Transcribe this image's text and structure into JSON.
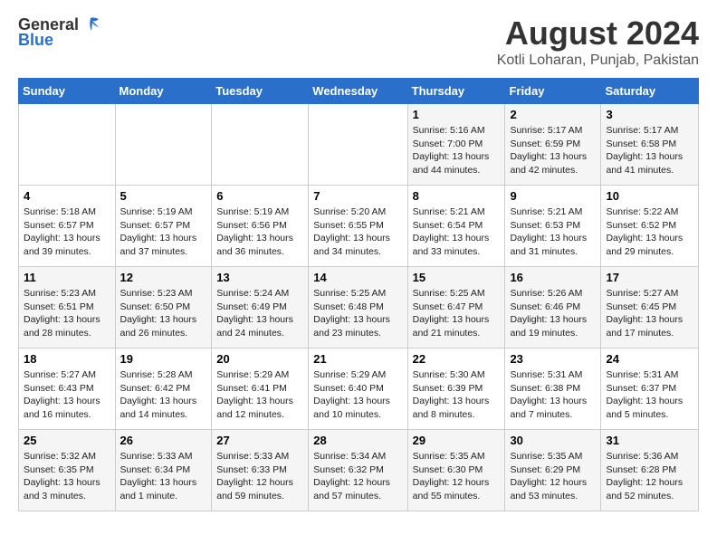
{
  "logo": {
    "general": "General",
    "blue": "Blue"
  },
  "title": "August 2024",
  "subtitle": "Kotli Loharan, Punjab, Pakistan",
  "days_of_week": [
    "Sunday",
    "Monday",
    "Tuesday",
    "Wednesday",
    "Thursday",
    "Friday",
    "Saturday"
  ],
  "weeks": [
    [
      {
        "day": "",
        "info": ""
      },
      {
        "day": "",
        "info": ""
      },
      {
        "day": "",
        "info": ""
      },
      {
        "day": "",
        "info": ""
      },
      {
        "day": "1",
        "info": "Sunrise: 5:16 AM\nSunset: 7:00 PM\nDaylight: 13 hours\nand 44 minutes."
      },
      {
        "day": "2",
        "info": "Sunrise: 5:17 AM\nSunset: 6:59 PM\nDaylight: 13 hours\nand 42 minutes."
      },
      {
        "day": "3",
        "info": "Sunrise: 5:17 AM\nSunset: 6:58 PM\nDaylight: 13 hours\nand 41 minutes."
      }
    ],
    [
      {
        "day": "4",
        "info": "Sunrise: 5:18 AM\nSunset: 6:57 PM\nDaylight: 13 hours\nand 39 minutes."
      },
      {
        "day": "5",
        "info": "Sunrise: 5:19 AM\nSunset: 6:57 PM\nDaylight: 13 hours\nand 37 minutes."
      },
      {
        "day": "6",
        "info": "Sunrise: 5:19 AM\nSunset: 6:56 PM\nDaylight: 13 hours\nand 36 minutes."
      },
      {
        "day": "7",
        "info": "Sunrise: 5:20 AM\nSunset: 6:55 PM\nDaylight: 13 hours\nand 34 minutes."
      },
      {
        "day": "8",
        "info": "Sunrise: 5:21 AM\nSunset: 6:54 PM\nDaylight: 13 hours\nand 33 minutes."
      },
      {
        "day": "9",
        "info": "Sunrise: 5:21 AM\nSunset: 6:53 PM\nDaylight: 13 hours\nand 31 minutes."
      },
      {
        "day": "10",
        "info": "Sunrise: 5:22 AM\nSunset: 6:52 PM\nDaylight: 13 hours\nand 29 minutes."
      }
    ],
    [
      {
        "day": "11",
        "info": "Sunrise: 5:23 AM\nSunset: 6:51 PM\nDaylight: 13 hours\nand 28 minutes."
      },
      {
        "day": "12",
        "info": "Sunrise: 5:23 AM\nSunset: 6:50 PM\nDaylight: 13 hours\nand 26 minutes."
      },
      {
        "day": "13",
        "info": "Sunrise: 5:24 AM\nSunset: 6:49 PM\nDaylight: 13 hours\nand 24 minutes."
      },
      {
        "day": "14",
        "info": "Sunrise: 5:25 AM\nSunset: 6:48 PM\nDaylight: 13 hours\nand 23 minutes."
      },
      {
        "day": "15",
        "info": "Sunrise: 5:25 AM\nSunset: 6:47 PM\nDaylight: 13 hours\nand 21 minutes."
      },
      {
        "day": "16",
        "info": "Sunrise: 5:26 AM\nSunset: 6:46 PM\nDaylight: 13 hours\nand 19 minutes."
      },
      {
        "day": "17",
        "info": "Sunrise: 5:27 AM\nSunset: 6:45 PM\nDaylight: 13 hours\nand 17 minutes."
      }
    ],
    [
      {
        "day": "18",
        "info": "Sunrise: 5:27 AM\nSunset: 6:43 PM\nDaylight: 13 hours\nand 16 minutes."
      },
      {
        "day": "19",
        "info": "Sunrise: 5:28 AM\nSunset: 6:42 PM\nDaylight: 13 hours\nand 14 minutes."
      },
      {
        "day": "20",
        "info": "Sunrise: 5:29 AM\nSunset: 6:41 PM\nDaylight: 13 hours\nand 12 minutes."
      },
      {
        "day": "21",
        "info": "Sunrise: 5:29 AM\nSunset: 6:40 PM\nDaylight: 13 hours\nand 10 minutes."
      },
      {
        "day": "22",
        "info": "Sunrise: 5:30 AM\nSunset: 6:39 PM\nDaylight: 13 hours\nand 8 minutes."
      },
      {
        "day": "23",
        "info": "Sunrise: 5:31 AM\nSunset: 6:38 PM\nDaylight: 13 hours\nand 7 minutes."
      },
      {
        "day": "24",
        "info": "Sunrise: 5:31 AM\nSunset: 6:37 PM\nDaylight: 13 hours\nand 5 minutes."
      }
    ],
    [
      {
        "day": "25",
        "info": "Sunrise: 5:32 AM\nSunset: 6:35 PM\nDaylight: 13 hours\nand 3 minutes."
      },
      {
        "day": "26",
        "info": "Sunrise: 5:33 AM\nSunset: 6:34 PM\nDaylight: 13 hours\nand 1 minute."
      },
      {
        "day": "27",
        "info": "Sunrise: 5:33 AM\nSunset: 6:33 PM\nDaylight: 12 hours\nand 59 minutes."
      },
      {
        "day": "28",
        "info": "Sunrise: 5:34 AM\nSunset: 6:32 PM\nDaylight: 12 hours\nand 57 minutes."
      },
      {
        "day": "29",
        "info": "Sunrise: 5:35 AM\nSunset: 6:30 PM\nDaylight: 12 hours\nand 55 minutes."
      },
      {
        "day": "30",
        "info": "Sunrise: 5:35 AM\nSunset: 6:29 PM\nDaylight: 12 hours\nand 53 minutes."
      },
      {
        "day": "31",
        "info": "Sunrise: 5:36 AM\nSunset: 6:28 PM\nDaylight: 12 hours\nand 52 minutes."
      }
    ]
  ]
}
